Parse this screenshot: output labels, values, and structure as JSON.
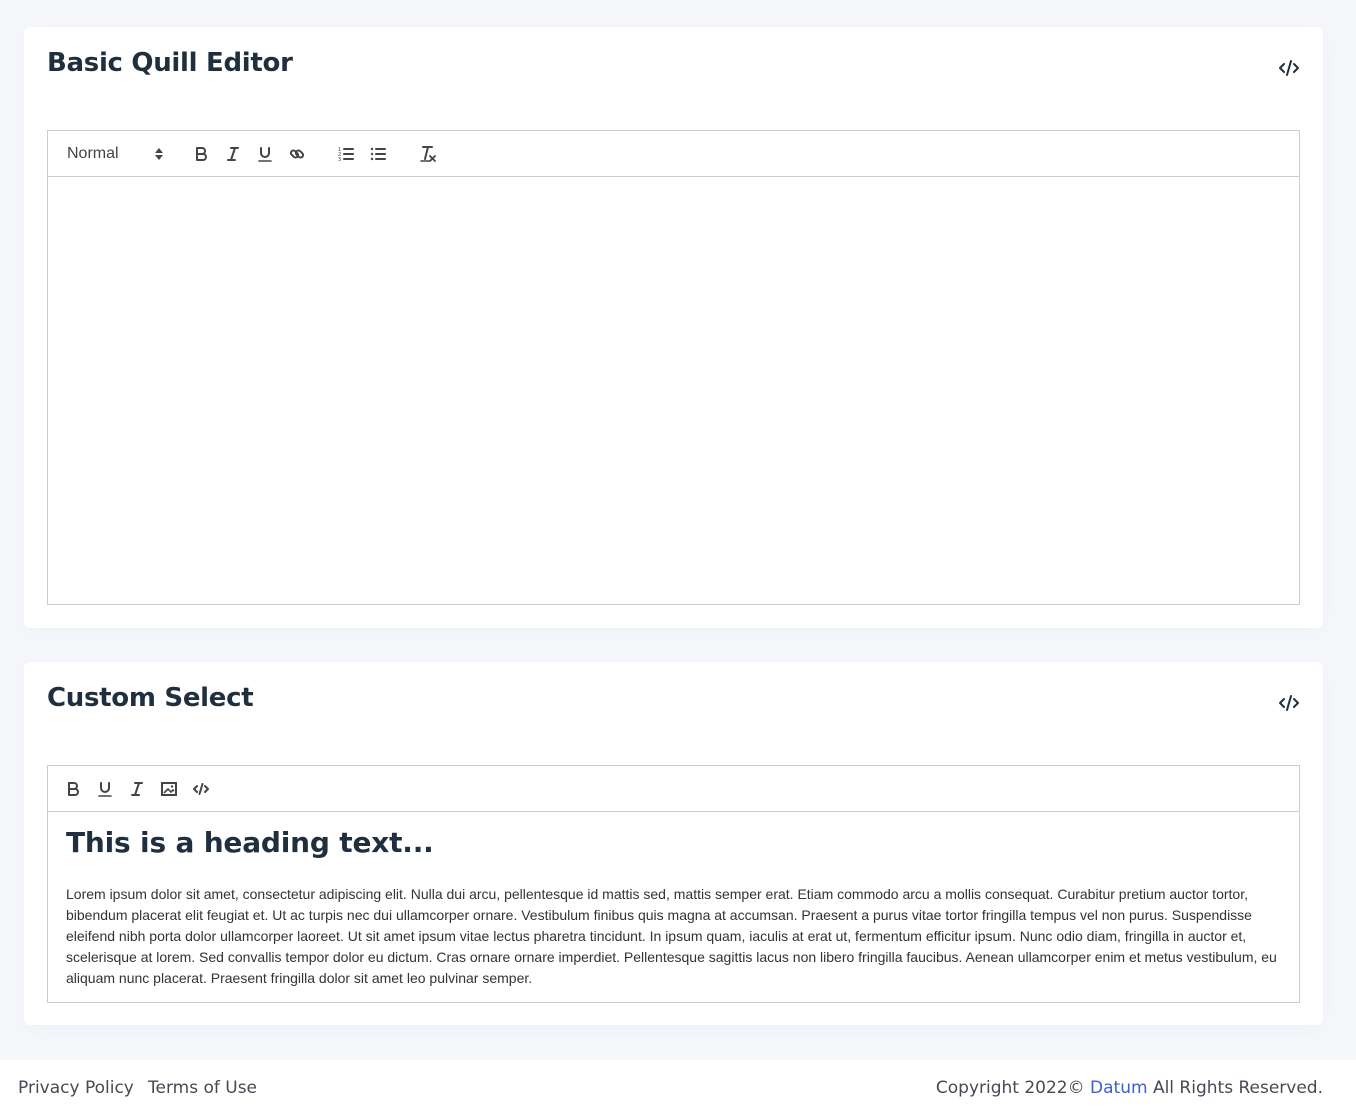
{
  "cards": [
    {
      "title": "Basic Quill Editor",
      "code_icon": "code-icon",
      "toolbar": {
        "header_select": "Normal",
        "buttons": [
          "bold-icon",
          "italic-icon",
          "underline-icon",
          "link-icon",
          "ordered-list-icon",
          "bullet-list-icon",
          "clear-format-icon"
        ]
      },
      "content": ""
    },
    {
      "title": "Custom Select",
      "code_icon": "code-icon",
      "toolbar": {
        "buttons": [
          "bold-icon",
          "underline-icon",
          "italic-icon",
          "image-icon",
          "code-icon"
        ]
      },
      "content_heading": "This is a heading text...",
      "content_paragraph": "Lorem ipsum dolor sit amet, consectetur adipiscing elit. Nulla dui arcu, pellentesque id mattis sed, mattis semper erat. Etiam commodo arcu a mollis consequat. Curabitur pretium auctor tortor, bibendum placerat elit feugiat et. Ut ac turpis nec dui ullamcorper ornare. Vestibulum finibus quis magna at accumsan. Praesent a purus vitae tortor fringilla tempus vel non purus. Suspendisse eleifend nibh porta dolor ullamcorper laoreet. Ut sit amet ipsum vitae lectus pharetra tincidunt. In ipsum quam, iaculis at erat ut, fermentum efficitur ipsum. Nunc odio diam, fringilla in auctor et, scelerisque at lorem. Sed convallis tempor dolor eu dictum. Cras ornare ornare imperdiet. Pellentesque sagittis lacus non libero fringilla faucibus. Aenean ullamcorper enim et metus vestibulum, eu aliquam nunc placerat. Praesent fringilla dolor sit amet leo pulvinar semper."
    }
  ],
  "footer": {
    "privacy": "Privacy Policy",
    "terms": "Terms of Use",
    "copyright_prefix": "Copyright 2022©",
    "brand": "Datum",
    "copyright_suffix": "All Rights Reserved."
  },
  "colors": {
    "page_background": "#f5f7fb",
    "card_background": "#ffffff",
    "title": "#1f2f3e",
    "brand_link": "#3e5fce",
    "editor_border": "#cccccc"
  }
}
